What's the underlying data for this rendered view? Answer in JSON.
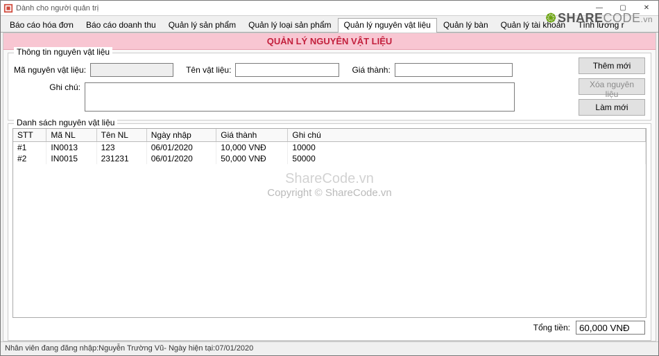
{
  "window": {
    "title": "Dành cho người quản trị"
  },
  "tabs": [
    {
      "label": "Báo cáo hóa đơn",
      "active": false
    },
    {
      "label": "Báo cáo doanh thu",
      "active": false
    },
    {
      "label": "Quản lý sản phẩm",
      "active": false
    },
    {
      "label": "Quản lý loại sản phẩm",
      "active": false
    },
    {
      "label": "Quản lý nguyên vật liệu",
      "active": true
    },
    {
      "label": "Quản lý bàn",
      "active": false
    },
    {
      "label": "Quản lý tài khoản",
      "active": false
    },
    {
      "label": "Tính lương r",
      "active": false
    }
  ],
  "banner": "QUẢN LÝ NGUYÊN VẬT LIỆU",
  "form": {
    "legend": "Thông tin nguyên vật liệu",
    "labels": {
      "ma": "Mã nguyên vật liệu:",
      "ten": "Tên vật liệu:",
      "gia": "Giá thành:",
      "ghichu": "Ghi chú:"
    },
    "values": {
      "ma": "",
      "ten": "",
      "gia": "",
      "ghichu": ""
    }
  },
  "buttons": {
    "add": "Thêm mới",
    "delete": "Xóa nguyên liệu",
    "refresh": "Làm mới"
  },
  "list": {
    "legend": "Danh sách nguyên vật liệu",
    "columns": [
      "STT",
      "Mã NL",
      "Tên NL",
      "Ngày nhập",
      "Giá thành",
      "Ghi chú"
    ],
    "rows": [
      {
        "stt": "#1",
        "ma": "IN0013",
        "ten": "123",
        "ngay": "06/01/2020",
        "gia": "10,000 VNĐ",
        "ghichu": "10000"
      },
      {
        "stt": "#2",
        "ma": "IN0015",
        "ten": "231231",
        "ngay": "06/01/2020",
        "gia": "50,000 VNĐ",
        "ghichu": "50000"
      }
    ]
  },
  "total": {
    "label": "Tổng tiền:",
    "value": "60,000 VNĐ"
  },
  "status": {
    "prefix": "Nhân viên đang đăng nhập: ",
    "user": "Nguyễn Trường Vũ",
    "sep": "   - Ngày hiện tại: ",
    "date": "07/01/2020"
  },
  "watermark": {
    "line1": "ShareCode.vn",
    "line2": "Copyright © ShareCode.vn",
    "logo_a": "SHARE",
    "logo_b": "CODE",
    "logo_c": ".vn"
  }
}
